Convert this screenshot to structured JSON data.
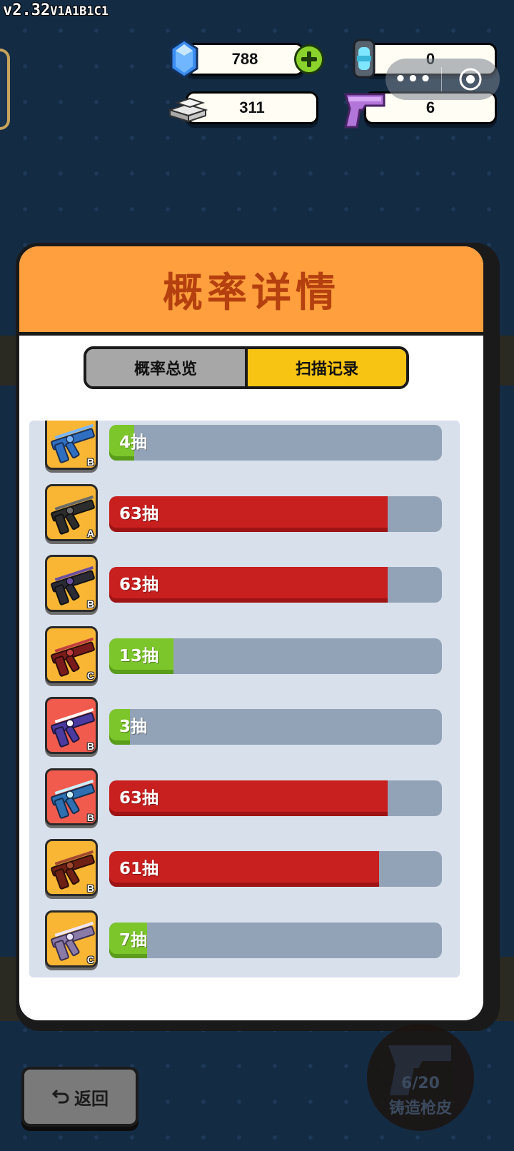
{
  "version": {
    "main": "v2.32",
    "suffix": "V1A1B1C1"
  },
  "resources": {
    "gems": "788",
    "silver": "311",
    "capsule": "0",
    "pistol": "6"
  },
  "icons": [
    "gem-icon",
    "plus-icon",
    "silver-bar-icon",
    "capsule-icon",
    "pistol-icon",
    "more-dots-icon",
    "target-icon",
    "back-arrow-icon"
  ],
  "modal": {
    "title": "概率详情",
    "tabs": [
      {
        "label": "概率总览",
        "active": false
      },
      {
        "label": "扫描记录",
        "active": true
      }
    ],
    "max_draws": 63,
    "records": [
      {
        "grade": "B",
        "draws": 4,
        "label": "4抽",
        "card": "orange",
        "gun": "blue",
        "bar": "green"
      },
      {
        "grade": "A",
        "draws": 63,
        "label": "63抽",
        "card": "orange",
        "gun": "black",
        "bar": "red"
      },
      {
        "grade": "B",
        "draws": 63,
        "label": "63抽",
        "card": "orange",
        "gun": "purple",
        "bar": "red"
      },
      {
        "grade": "C",
        "draws": 13,
        "label": "13抽",
        "card": "orange",
        "gun": "crimson",
        "bar": "green"
      },
      {
        "grade": "B",
        "draws": 3,
        "label": "3抽",
        "card": "red",
        "gun": "galaxy",
        "bar": "green"
      },
      {
        "grade": "B",
        "draws": 63,
        "label": "63抽",
        "card": "red",
        "gun": "ice",
        "bar": "red"
      },
      {
        "grade": "B",
        "draws": 61,
        "label": "61抽",
        "card": "orange",
        "gun": "rust",
        "bar": "red"
      },
      {
        "grade": "C",
        "draws": 7,
        "label": "7抽",
        "card": "orange",
        "gun": "lilac",
        "bar": "green"
      }
    ]
  },
  "footer": {
    "back_label": "返回",
    "forge_count": "6/20",
    "forge_label": "铸造枪皮"
  },
  "colors": {
    "background": "#142b44",
    "header_orange": "#ff9f3e",
    "title_text": "#b5400f",
    "active_tab": "#f8c414",
    "bar_green": "#7cc52b",
    "bar_red": "#c81f1f",
    "bar_track": "#93a3b7"
  }
}
